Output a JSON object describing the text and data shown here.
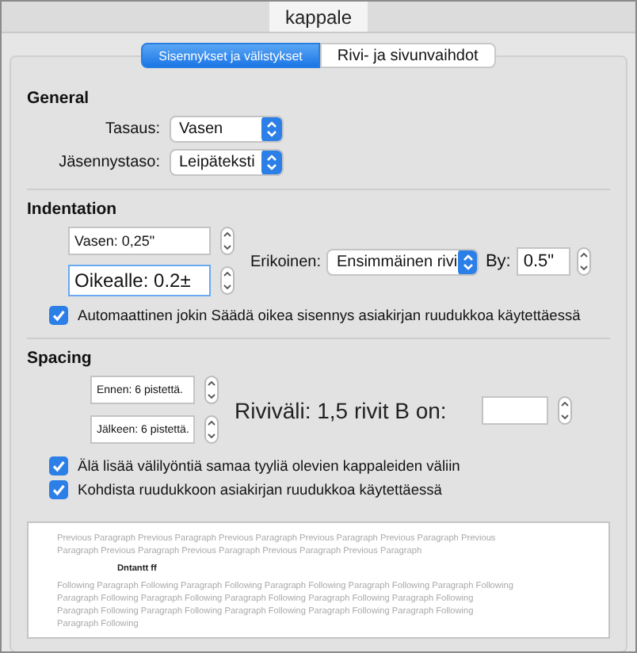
{
  "window": {
    "title": "kappale"
  },
  "tabs": [
    {
      "label": "Sisennykset ja välistykset",
      "selected": true
    },
    {
      "label": "Rivi- ja sivunvaihdot",
      "selected": false
    }
  ],
  "general": {
    "heading": "General",
    "fields": [
      {
        "label": "Tasaus:",
        "value": "Vasen"
      },
      {
        "label": "Jäsennystaso:",
        "value": "Leipäteksti"
      }
    ]
  },
  "indentation": {
    "heading": "Indentation",
    "left": {
      "label": "Vasen:",
      "value": "0,25\""
    },
    "right": {
      "label": "Oikealle:",
      "value": "0.2±"
    },
    "special": {
      "label": "Erikoinen:",
      "value": "Ensimmäinen rivi"
    },
    "by": {
      "label": "By:",
      "value": "0.5\""
    },
    "checkbox": {
      "label": "Automaattinen jokin Säädä oikea sisennys asiakirjan ruudukkoa käytettäessä",
      "checked": true
    }
  },
  "spacing": {
    "heading": "Spacing",
    "before": {
      "label": "Ennen:",
      "value": "6 pistettä."
    },
    "after": {
      "label": "Jälkeen:",
      "value": "6 pistettä."
    },
    "line": {
      "label": "Riviväli: 1,5 rivit B on:"
    },
    "checkboxes": [
      {
        "label": "Älä lisää välilyöntiä samaa tyyliä olevien kappaleiden väliin",
        "checked": true
      },
      {
        "label": "Kohdista ruudukkoon asiakirjan ruudukkoa käytettäessä",
        "checked": true
      }
    ]
  },
  "preview": {
    "previous": "Previous Paragraph Previous Paragraph Previous Paragraph Previous Paragraph Previous Paragraph Previous Paragraph Previous Paragraph Previous Paragraph Previous Paragraph Previous Paragraph",
    "sample": "Dntantt ff",
    "following": "Following Paragraph Following Paragraph Following Paragraph Following Paragraph Following Paragraph Following Paragraph Following Paragraph Following Paragraph Following Paragraph Following Paragraph Following Paragraph Following Paragraph Following Paragraph Following Paragraph Following Paragraph Following Paragraph Following"
  }
}
